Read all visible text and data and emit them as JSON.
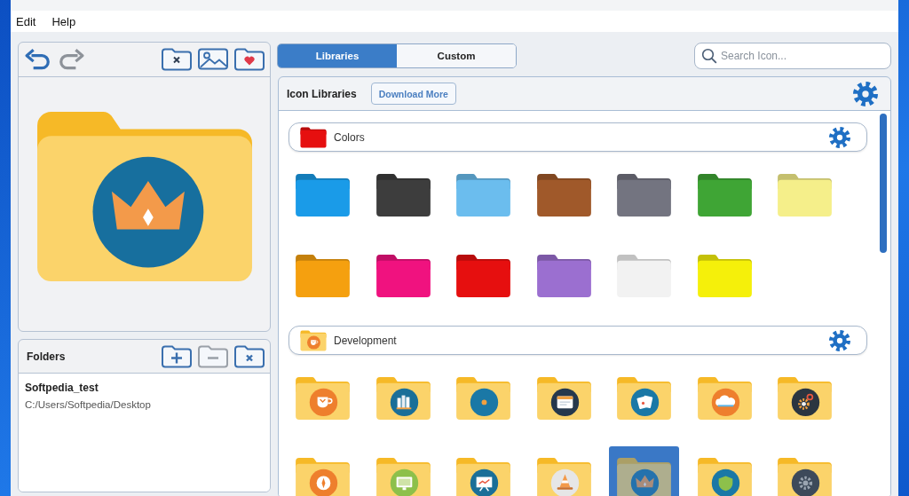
{
  "menu": [
    {
      "label": "Edit"
    },
    {
      "label": "Help"
    }
  ],
  "editor": {
    "history": [
      {
        "kind": "undo",
        "disabled": false
      },
      {
        "kind": "redo",
        "disabled": true
      }
    ],
    "actions": [
      {
        "kind": "remove-icon",
        "disabled": false
      },
      {
        "kind": "picture",
        "disabled": false
      },
      {
        "kind": "favorite",
        "disabled": false
      }
    ],
    "preview": {
      "kind": "crown"
    }
  },
  "folders": {
    "title": "Folders",
    "actions": [
      {
        "kind": "add",
        "disabled": false
      },
      {
        "kind": "remove",
        "disabled": true
      },
      {
        "kind": "clear",
        "disabled": false
      }
    ],
    "items": [
      {
        "name": "Softpedia_test",
        "path": "C:/Users/Softpedia/Desktop"
      }
    ]
  },
  "tabs": [
    {
      "label": "Libraries",
      "selected": true
    },
    {
      "label": "Custom",
      "selected": false
    }
  ],
  "search": {
    "placeholder": "Search Icon..."
  },
  "libraries_panel": {
    "title": "Icon Libraries",
    "download_button": "Download More",
    "libraries": [
      {
        "name": "Colors",
        "icon": {
          "kind": "plain",
          "color": "#e60f0f"
        },
        "icons": [
          {
            "kind": "plain",
            "color": "#1a9be8",
            "selected": false
          },
          {
            "kind": "plain",
            "color": "#3d3d3d",
            "selected": false
          },
          {
            "kind": "plain",
            "color": "#6bbdee",
            "selected": false
          },
          {
            "kind": "plain",
            "color": "#a0592a",
            "selected": false
          },
          {
            "kind": "plain",
            "color": "#737480",
            "selected": false
          },
          {
            "kind": "plain",
            "color": "#3fa535",
            "selected": false
          },
          {
            "kind": "plain",
            "color": "#f5ef8a",
            "selected": false
          },
          {
            "kind": "plain",
            "color": "#f5a00f",
            "selected": false
          },
          {
            "kind": "plain",
            "color": "#f0127f",
            "selected": false
          },
          {
            "kind": "plain",
            "color": "#e60f0f",
            "selected": false
          },
          {
            "kind": "plain",
            "color": "#9b6fd0",
            "selected": false
          },
          {
            "kind": "plain",
            "color": "#f2f2f2",
            "selected": false
          },
          {
            "kind": "plain",
            "color": "#f5f00a",
            "selected": false
          }
        ]
      },
      {
        "name": "Development",
        "icon": {
          "kind": "mug"
        },
        "icons": [
          {
            "kind": "mug",
            "selected": false
          },
          {
            "kind": "books",
            "selected": false
          },
          {
            "kind": "disc",
            "selected": false
          },
          {
            "kind": "window",
            "selected": false
          },
          {
            "kind": "cards",
            "selected": false
          },
          {
            "kind": "cloud",
            "selected": false
          },
          {
            "kind": "gears",
            "selected": false
          },
          {
            "kind": "compass",
            "selected": false
          },
          {
            "kind": "monitor",
            "selected": false
          },
          {
            "kind": "easel",
            "selected": false
          },
          {
            "kind": "cone",
            "selected": false
          },
          {
            "kind": "crown",
            "selected": true
          },
          {
            "kind": "shield",
            "selected": false
          },
          {
            "kind": "cog",
            "selected": false
          }
        ]
      }
    ]
  }
}
